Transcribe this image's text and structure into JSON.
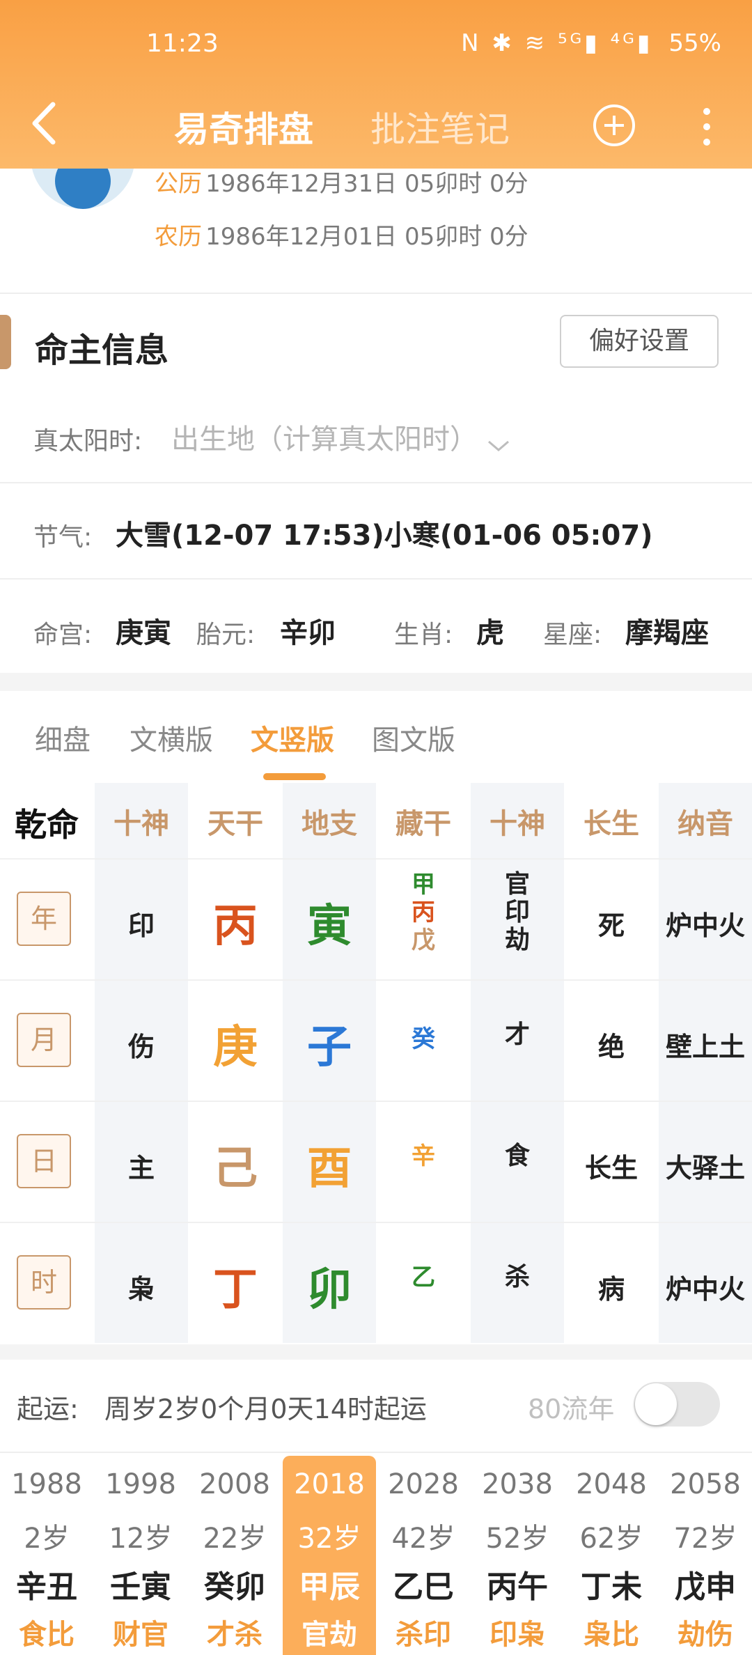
{
  "status": {
    "time": "11:23",
    "icons": "N ✱ ≋ ⁵ᴳ▮ ⁴ᴳ▮",
    "battery": "55%"
  },
  "header": {
    "tab_pan": "易奇排盘",
    "tab_note": "批注笔记"
  },
  "birth": {
    "solar_label": "公历",
    "solar_value": "1986年12月31日 05卯时 0分",
    "lunar_label": "农历",
    "lunar_value": "1986年12月01日 05卯时 0分"
  },
  "section": {
    "title": "命主信息",
    "pref_button": "偏好设置"
  },
  "solar_time": {
    "label": "真太阳时:",
    "value": "出生地（计算真太阳时）"
  },
  "jieqi": {
    "label": "节气:",
    "value": "大雪(12-07 17:53)小寒(01-06 05:07)"
  },
  "info": {
    "minggong_label": "命宫:",
    "minggong": "庚寅",
    "taiyuan_label": "胎元:",
    "taiyuan": "辛卯",
    "shengxiao_label": "生肖:",
    "shengxiao": "虎",
    "xingzuo_label": "星座:",
    "xingzuo": "摩羯座"
  },
  "view_tabs": [
    "细盘",
    "文横版",
    "文竖版",
    "图文版"
  ],
  "table": {
    "corner": "乾命",
    "headers": [
      "十神",
      "天干",
      "地支",
      "藏干",
      "十神",
      "长生",
      "纳音"
    ],
    "rows": [
      {
        "label": "年",
        "shishen": "印",
        "gan": "丙",
        "zhi": "寅",
        "cang": [
          "甲",
          "丙",
          "戊"
        ],
        "shen2": [
          "官",
          "印",
          "劫"
        ],
        "changsheng": "死",
        "nayin": "炉中火"
      },
      {
        "label": "月",
        "shishen": "伤",
        "gan": "庚",
        "zhi": "子",
        "cang": [
          "癸"
        ],
        "shen2": [
          "才"
        ],
        "changsheng": "绝",
        "nayin": "壁上土"
      },
      {
        "label": "日",
        "shishen": "主",
        "gan": "己",
        "zhi": "酉",
        "cang": [
          "辛"
        ],
        "shen2": [
          "食"
        ],
        "changsheng": "长生",
        "nayin": "大驿土"
      },
      {
        "label": "时",
        "shishen": "枭",
        "gan": "丁",
        "zhi": "卯",
        "cang": [
          "乙"
        ],
        "shen2": [
          "杀"
        ],
        "changsheng": "病",
        "nayin": "炉中火"
      }
    ],
    "colors": {
      "fire": "#d9531e",
      "wood": "#2e8b2e",
      "metal": "#f2a134",
      "water": "#2b78d6",
      "earth": "#c8976a"
    }
  },
  "qiyun": {
    "label": "起运:",
    "value": "周岁2岁0个月0天14时起运",
    "liunian_label": "80流年"
  },
  "dayun": [
    {
      "year": "1988",
      "age": "2岁",
      "ganzhi": "辛丑",
      "shishen": "食比"
    },
    {
      "year": "1998",
      "age": "12岁",
      "ganzhi": "壬寅",
      "shishen": "财官"
    },
    {
      "year": "2008",
      "age": "22岁",
      "ganzhi": "癸卯",
      "shishen": "才杀"
    },
    {
      "year": "2018",
      "age": "32岁",
      "ganzhi": "甲辰",
      "shishen": "官劫"
    },
    {
      "year": "2028",
      "age": "42岁",
      "ganzhi": "乙巳",
      "shishen": "杀印"
    },
    {
      "year": "2038",
      "age": "52岁",
      "ganzhi": "丙午",
      "shishen": "印枭"
    },
    {
      "year": "2048",
      "age": "62岁",
      "ganzhi": "丁未",
      "shishen": "枭比"
    },
    {
      "year": "2058",
      "age": "72岁",
      "ganzhi": "戊申",
      "shishen": "劫伤"
    }
  ]
}
